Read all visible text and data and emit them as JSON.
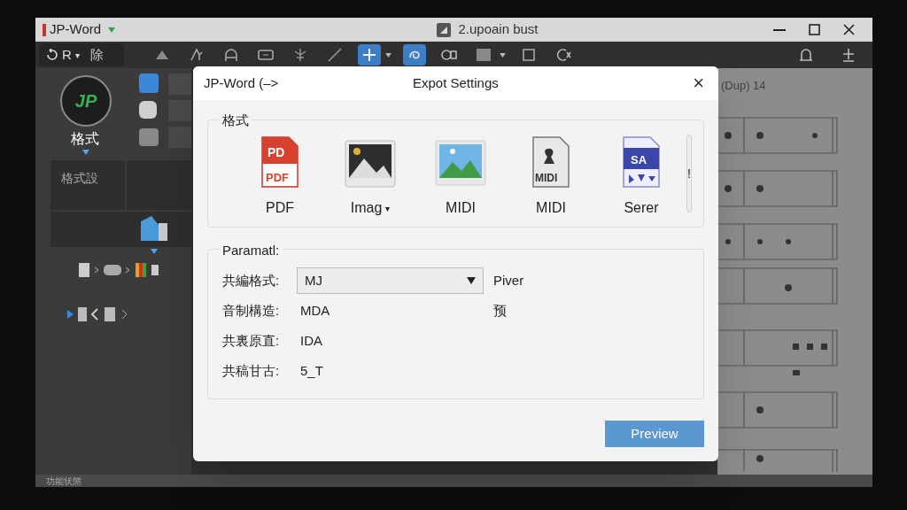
{
  "window": {
    "app_name": "JP-Word",
    "title": "2.upoain bust"
  },
  "toolbar": {
    "left_label": "R",
    "left_caret": "▾",
    "left_text": "除",
    "buttons": [
      {
        "kind": "triangle",
        "selected": false
      },
      {
        "kind": "arrow",
        "selected": false
      },
      {
        "kind": "arch",
        "selected": false
      },
      {
        "kind": "screen",
        "selected": false
      },
      {
        "kind": "branch",
        "selected": false
      },
      {
        "kind": "pen",
        "selected": false
      },
      {
        "kind": "crosshair",
        "selected": true,
        "dropdown": true
      },
      {
        "kind": "loop",
        "selected": true
      },
      {
        "kind": "rings",
        "selected": false
      },
      {
        "kind": "square",
        "selected": false,
        "dropdown": true
      },
      {
        "kind": "flag",
        "selected": false
      },
      {
        "kind": "cursor",
        "selected": false
      }
    ],
    "right_buttons": [
      {
        "kind": "bell"
      },
      {
        "kind": "plus"
      }
    ]
  },
  "sidebar": {
    "logo": "JP",
    "label": "格式",
    "panel_title": "格式設"
  },
  "score": {
    "header": "(Dup) 14"
  },
  "status_bar": "功能状態",
  "dialog": {
    "app_label": "JP-Word (–>",
    "title": "Expot Settings",
    "close": "×",
    "format_group": {
      "title": "格式",
      "formats": [
        {
          "kind": "pdf",
          "label": "PDF",
          "icon_texts": [
            "PD",
            "PDF"
          ]
        },
        {
          "kind": "photo",
          "label": "Imag",
          "caret": "▾"
        },
        {
          "kind": "landscape",
          "label": "MIDI"
        },
        {
          "kind": "midi",
          "label": "MIDI",
          "icon_texts": [
            "MIDI"
          ]
        },
        {
          "kind": "score",
          "label": "Serer",
          "icon_texts": [
            "SA"
          ]
        }
      ],
      "more": "!"
    },
    "param_group": {
      "title": "Paramatl:",
      "rows": [
        {
          "kind": "select",
          "label": "共編格式:",
          "value": "MJ",
          "extra": "Piver"
        },
        {
          "kind": "text",
          "label": "音制構造:",
          "value": "MDA",
          "extra": "预"
        },
        {
          "kind": "text",
          "label": "共裏原直:",
          "value": "IDA"
        },
        {
          "kind": "text",
          "label": "共稿甘古:",
          "value": "5_T"
        }
      ]
    },
    "buttons": [
      "Preview"
    ]
  }
}
